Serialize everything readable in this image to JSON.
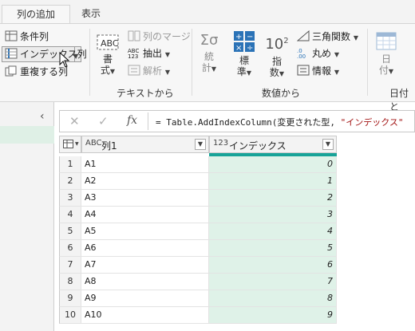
{
  "tabs": [
    {
      "label": "列の追加",
      "active": true
    },
    {
      "label": "表示",
      "active": false
    }
  ],
  "ribbon": {
    "general": {
      "conditional_column": "条件列",
      "index_column": "インデックス列",
      "duplicate_column": "重複する列"
    },
    "text_group": {
      "format_label": "書",
      "format_label2": "式",
      "merge_columns": "列のマージ",
      "extract": "抽出",
      "parse": "解析",
      "group_label": "テキストから"
    },
    "number_group": {
      "statistics": "統",
      "statistics2": "計",
      "standard": "標",
      "standard2": "準",
      "scientific_sup": "2",
      "scientific_base": "10",
      "scientific": "指",
      "scientific2": "数",
      "trigonometry": "三角関数",
      "rounding": "丸め",
      "information": "情報",
      "group_label": "数値から"
    },
    "date_group": {
      "date": "日",
      "date2": "付",
      "group_label": "日付と"
    }
  },
  "formula": {
    "prefix": "= Table.AddIndexColumn(変更された型, ",
    "string_arg": "\"インデックス\"",
    "suffix": ""
  },
  "grid": {
    "columns": [
      {
        "type_label": "ABC",
        "name": "列1"
      },
      {
        "type_label": "123",
        "name": "インデックス"
      }
    ],
    "rows": [
      {
        "num": "1",
        "col1": "A1",
        "idx": "0"
      },
      {
        "num": "2",
        "col1": "A2",
        "idx": "1"
      },
      {
        "num": "3",
        "col1": "A3",
        "idx": "2"
      },
      {
        "num": "4",
        "col1": "A4",
        "idx": "3"
      },
      {
        "num": "5",
        "col1": "A5",
        "idx": "4"
      },
      {
        "num": "6",
        "col1": "A6",
        "idx": "5"
      },
      {
        "num": "7",
        "col1": "A7",
        "idx": "6"
      },
      {
        "num": "8",
        "col1": "A8",
        "idx": "7"
      },
      {
        "num": "9",
        "col1": "A9",
        "idx": "8"
      },
      {
        "num": "10",
        "col1": "A10",
        "idx": "9"
      }
    ]
  },
  "colors": {
    "accent": "#17a398",
    "index_fill": "#dff2e8",
    "icon_blue": "#2b73b7"
  }
}
